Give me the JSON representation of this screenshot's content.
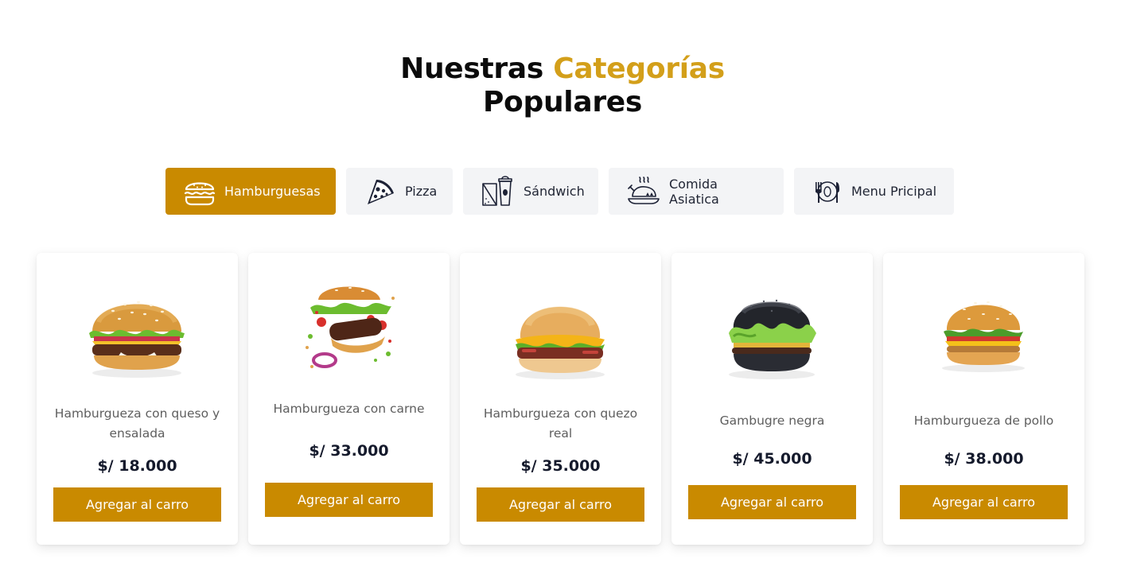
{
  "section": {
    "title_part1": "Nuestras",
    "title_accent": "Categorías",
    "title_part2": "Populares"
  },
  "colors": {
    "accent_text": "#d39f1a",
    "accent_button": "#c98a00",
    "tab_bg": "#f3f4f6",
    "price_text": "#151a2c"
  },
  "tabs": [
    {
      "label": "Hamburguesas",
      "icon": "burger-icon",
      "active": true
    },
    {
      "label": "Pizza",
      "icon": "pizza-icon",
      "active": false
    },
    {
      "label": "Sándwich",
      "icon": "sandwich-icon",
      "active": false
    },
    {
      "label": "Comida Asiatica",
      "icon": "roast-chicken-icon",
      "active": false
    },
    {
      "label": "Menu Pricipal",
      "icon": "cutlery-icon",
      "active": false
    }
  ],
  "products": [
    {
      "name": "Hamburgueza con queso y ensalada",
      "price": "$/ 18.000",
      "button": "Agregar al carro",
      "image": "burger-cheese-salad"
    },
    {
      "name": "Hamburgueza con carne",
      "price": "$/ 33.000",
      "button": "Agregar al carro",
      "image": "burger-flying-meat"
    },
    {
      "name": "Hamburgueza con quezo real",
      "price": "$/ 35.000",
      "button": "Agregar al carro",
      "image": "burger-real-cheese"
    },
    {
      "name": "Gambugre negra",
      "price": "$/ 45.000",
      "button": "Agregar al carro",
      "image": "black-burger"
    },
    {
      "name": "Hamburgueza de pollo",
      "price": "$/ 38.000",
      "button": "Agregar al carro",
      "image": "chicken-burger"
    }
  ]
}
